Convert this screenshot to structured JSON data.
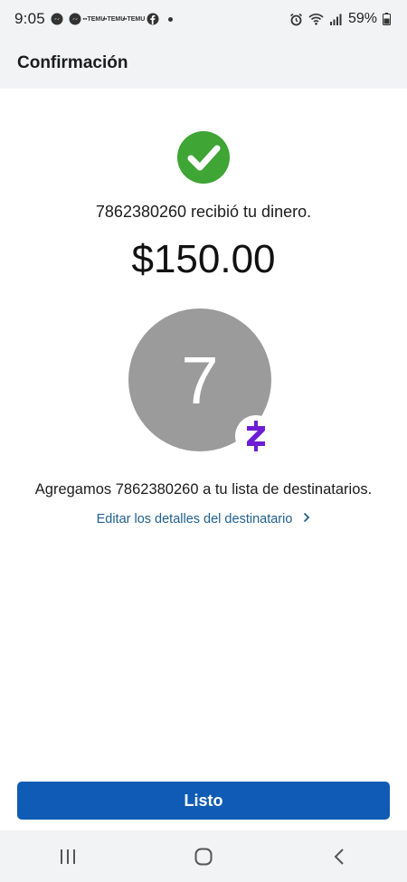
{
  "status_bar": {
    "time": "9:05",
    "notification_icons": [
      "messenger-icon",
      "messenger-icon",
      "temu-icon",
      "temu-icon",
      "temu-icon",
      "facebook-icon"
    ],
    "temu_label": "TEMU",
    "battery": "59%"
  },
  "header": {
    "title": "Confirmación"
  },
  "confirmation": {
    "received_text": "7862380260 recibió tu dinero.",
    "amount": "$150.00",
    "avatar_initial": "7",
    "added_text": "Agregamos 7862380260 a tu lista de destinatarios.",
    "edit_link": "Editar los detalles del destinatario"
  },
  "footer": {
    "done_button": "Listo"
  },
  "colors": {
    "success_green": "#3fa535",
    "primary_blue": "#0f5bb5",
    "link_blue": "#1f5f8f",
    "avatar_gray": "#9b9b9b",
    "zelle_purple": "#6d1ed4"
  }
}
